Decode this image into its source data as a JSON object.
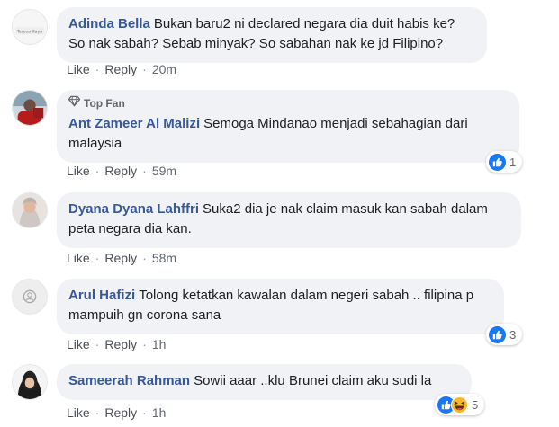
{
  "actions": {
    "like": "Like",
    "reply": "Reply",
    "separator": "·"
  },
  "badge": {
    "top_fan_label": "Top Fan"
  },
  "comments": [
    {
      "author": "Adinda Bella",
      "text": "Bukan baru2 ni declared negara dia duit habis ke? So nak sabah? Sebab minyak? So sabahan nak ke jd Filipino?",
      "time": "20m",
      "avatar_caption": "Teresa Kaya",
      "reactions": null
    },
    {
      "author": "Ant Zameer Al Malizi",
      "text": "Semoga Mindanao menjadi sebahagian dari malaysia",
      "time": "59m",
      "top_fan": true,
      "reactions": {
        "count": "1",
        "icons": [
          "like-icon"
        ]
      }
    },
    {
      "author": "Dyana Dyana Lahffri",
      "text": "Suka2 dia je nak claim masuk kan sabah dalam peta negara dia kan.",
      "time": "58m",
      "reactions": null
    },
    {
      "author": "Arul Hafizi",
      "text": "Tolong ketatkan kawalan dalam negeri sabah .. filipina p mampuih gn corona sana",
      "time": "1h",
      "reactions": {
        "count": "3",
        "icons": [
          "like-icon"
        ]
      }
    },
    {
      "author": "Sameerah Rahman",
      "text": "Sowii aaar ..klu Brunei claim aku sudi la",
      "time": "1h",
      "reactions": {
        "count": "5",
        "icons": [
          "like-icon",
          "haha-icon"
        ]
      }
    }
  ],
  "colors": {
    "author": "#385898",
    "bubble": "#f0f2f5",
    "like_blue": "#1877f2",
    "haha_yellow": "#f7b928"
  }
}
